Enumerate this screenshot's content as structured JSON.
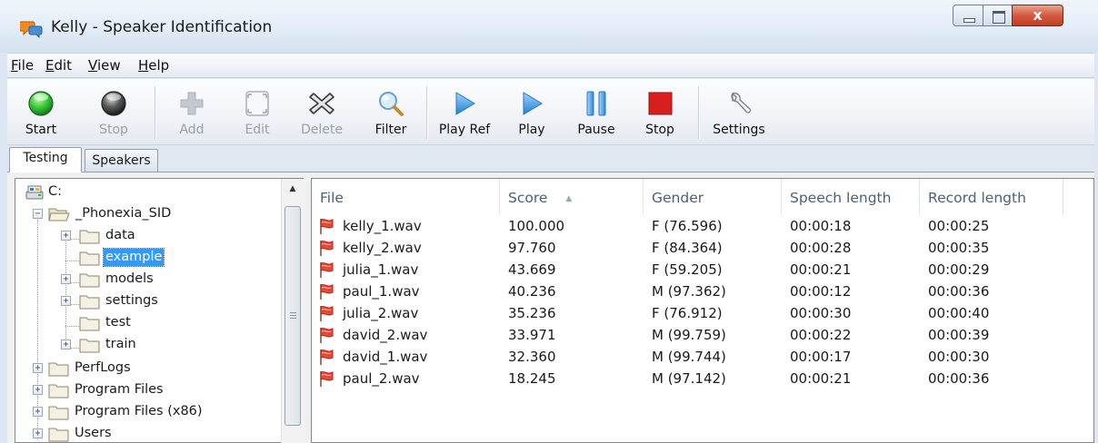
{
  "window": {
    "title": "Kelly - Speaker Identification",
    "close_glyph": "x"
  },
  "menu": [
    {
      "mnemonic": "F",
      "rest": "ile"
    },
    {
      "mnemonic": "E",
      "rest": "dit"
    },
    {
      "mnemonic": "V",
      "rest": "iew"
    },
    {
      "mnemonic": "H",
      "rest": "elp"
    }
  ],
  "toolbar": {
    "start": {
      "label": "Start",
      "icon": "green-circle-icon",
      "enabled": true
    },
    "stop": {
      "label": "Stop",
      "icon": "dark-circle-icon",
      "enabled": false
    },
    "add": {
      "label": "Add",
      "icon": "plus-icon",
      "enabled": false
    },
    "edit": {
      "label": "Edit",
      "icon": "edit-frame-icon",
      "enabled": false
    },
    "delete": {
      "label": "Delete",
      "icon": "delete-x-icon",
      "enabled": false
    },
    "filter": {
      "label": "Filter",
      "icon": "magnifier-icon",
      "enabled": true
    },
    "play_ref": {
      "label": "Play Ref",
      "icon": "play-icon",
      "enabled": true
    },
    "play": {
      "label": "Play",
      "icon": "play-icon",
      "enabled": true
    },
    "pause": {
      "label": "Pause",
      "icon": "pause-icon",
      "enabled": true
    },
    "stop_playback": {
      "label": "Stop",
      "icon": "stop-square-icon",
      "enabled": true
    },
    "settings": {
      "label": "Settings",
      "icon": "wrench-icon",
      "enabled": true
    }
  },
  "tabs": {
    "testing": "Testing",
    "speakers": "Speakers",
    "active": "Testing"
  },
  "tree": {
    "drive": "C:",
    "root_folder": "_Phonexia_SID",
    "children": [
      "data",
      "example",
      "models",
      "settings",
      "test",
      "train"
    ],
    "selected": "example",
    "drive_folders": [
      "PerfLogs",
      "Program Files",
      "Program Files (x86)",
      "Users"
    ]
  },
  "table": {
    "columns": [
      "File",
      "Score",
      "Gender",
      "Speech length",
      "Record length"
    ],
    "sorted_by": "Score",
    "rows": [
      {
        "file": "kelly_1.wav",
        "score": "100.000",
        "gender": "F (76.596)",
        "speech": "00:00:18",
        "record": "00:00:25"
      },
      {
        "file": "kelly_2.wav",
        "score": "97.760",
        "gender": "F (84.364)",
        "speech": "00:00:28",
        "record": "00:00:35"
      },
      {
        "file": "julia_1.wav",
        "score": "43.669",
        "gender": "F (59.205)",
        "speech": "00:00:21",
        "record": "00:00:29"
      },
      {
        "file": "paul_1.wav",
        "score": "40.236",
        "gender": "M (97.362)",
        "speech": "00:00:12",
        "record": "00:00:36"
      },
      {
        "file": "julia_2.wav",
        "score": "35.236",
        "gender": "F (76.912)",
        "speech": "00:00:30",
        "record": "00:00:40"
      },
      {
        "file": "david_2.wav",
        "score": "33.971",
        "gender": "M (99.759)",
        "speech": "00:00:22",
        "record": "00:00:39"
      },
      {
        "file": "david_1.wav",
        "score": "32.360",
        "gender": "M (99.744)",
        "speech": "00:00:17",
        "record": "00:00:30"
      },
      {
        "file": "paul_2.wav",
        "score": "18.245",
        "gender": "M (97.142)",
        "speech": "00:00:21",
        "record": "00:00:36"
      }
    ]
  },
  "colors": {
    "selection": "#3399ff",
    "close_button": "#c9472d",
    "play_blue": "#2f8fe0",
    "stop_red": "#d81e1e",
    "start_green": "#2fbf3a"
  }
}
